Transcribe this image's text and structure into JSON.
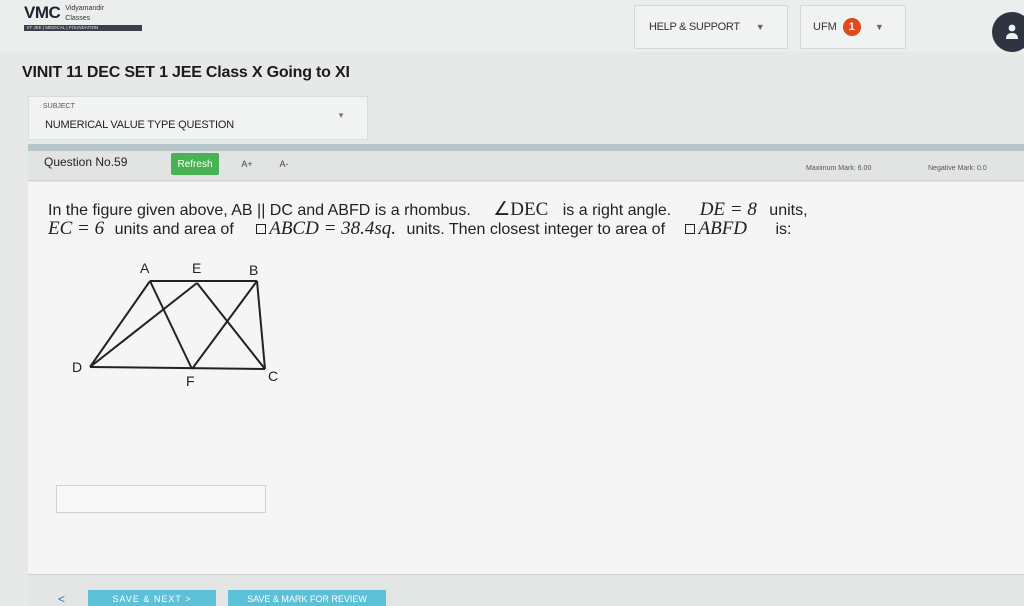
{
  "header": {
    "logo": {
      "brand": "VMC",
      "sub_line1": "Vidyamandir",
      "sub_line2": "Classes",
      "tagline": "IIT JEE | MEDICAL | FOUNDATION"
    },
    "help_label": "HELP & SUPPORT",
    "ufm_label": "UFM",
    "ufm_count": "1",
    "avatar_icon": "user-icon"
  },
  "test_title": "VINIT 11 DEC SET 1 JEE Class X Going to XI",
  "subject": {
    "label": "SUBJECT",
    "value": "NUMERICAL VALUE TYPE QUESTION"
  },
  "question_bar": {
    "question_no": "Question No.59",
    "refresh_label": "Refresh",
    "font_increase": "A+",
    "font_decrease": "A-",
    "max_mark": "Maximum Mark: 6.00",
    "negative_mark": "Negative Mark: 0.0"
  },
  "question": {
    "line1_a": "In the figure given above, AB || DC and ABFD is a rhombus.",
    "line1_angle": "∠DEC",
    "line1_b": "is a right angle.",
    "line1_de": "DE = 8",
    "line1_c": "units,",
    "line2_ec": "EC = 6",
    "line2_a": "units and area of",
    "line2_area": "ABCD = 38.4sq.",
    "line2_b": "units. Then closest integer to area of",
    "line2_abfd": "ABFD",
    "line2_c": "is:"
  },
  "figure": {
    "A": "A",
    "E": "E",
    "B": "B",
    "D": "D",
    "F": "F",
    "C": "C"
  },
  "footer": {
    "back": "<",
    "save_next": "SAVE & NEXT >",
    "mark_review": "SAVE & MARK FOR REVIEW"
  }
}
